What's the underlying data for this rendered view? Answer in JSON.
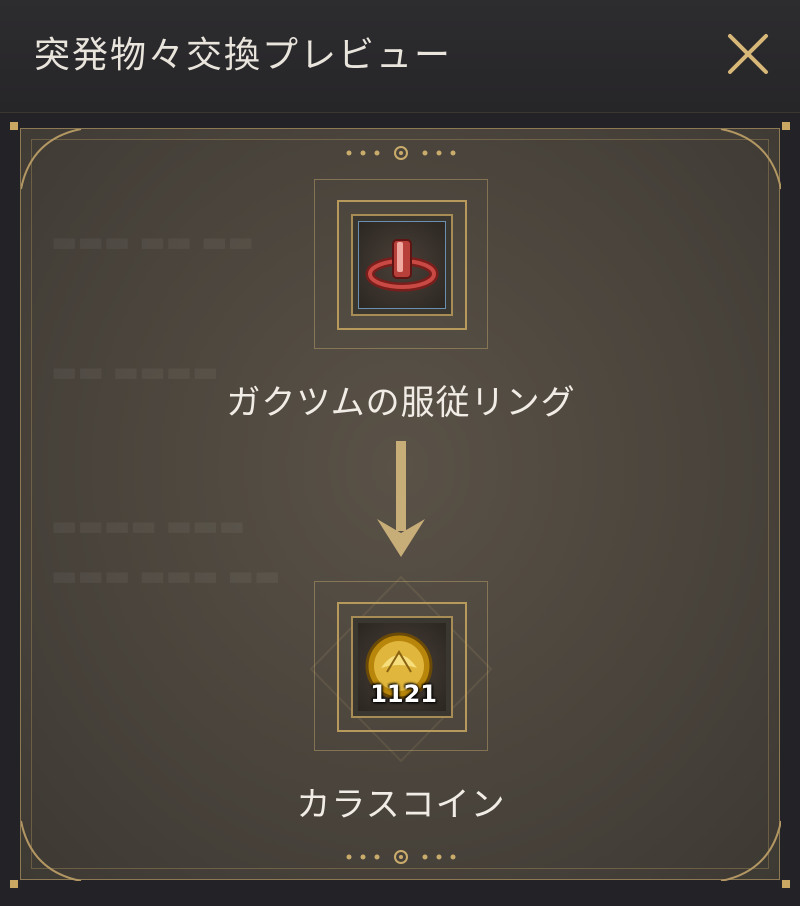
{
  "dialog": {
    "title": "突発物々交換プレビュー"
  },
  "source_item": {
    "name": "ガクツムの服従リング",
    "icon": "ring-icon"
  },
  "result_item": {
    "name": "カラスコイン",
    "icon": "coin-icon",
    "quantity": "1121"
  },
  "colors": {
    "gold": "#c9ab6b",
    "panel": "#4d463e",
    "titlebar": "#2a292c"
  }
}
